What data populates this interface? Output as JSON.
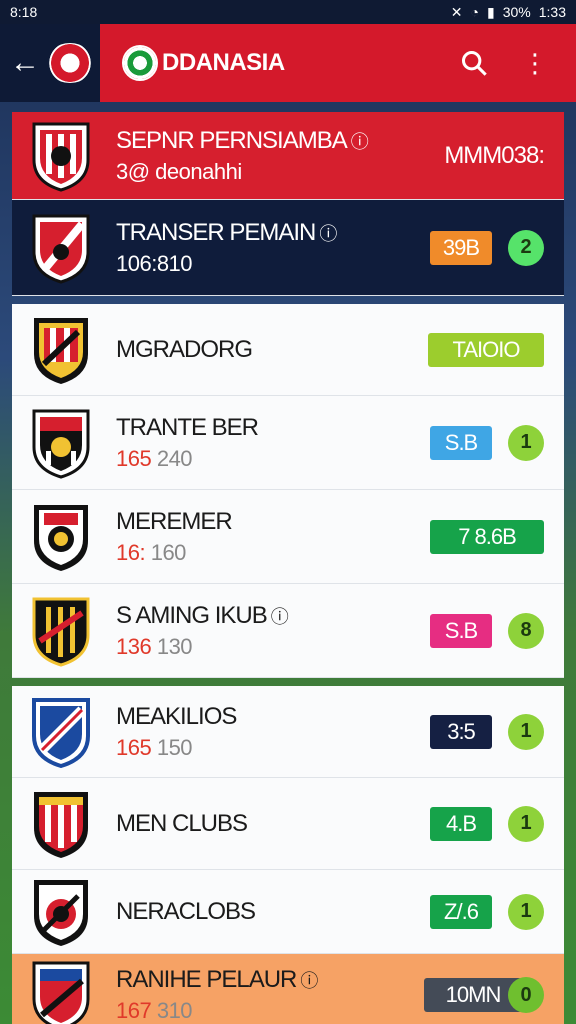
{
  "status_bar": {
    "time": "8:18",
    "battery": "30%",
    "clock": "1:33",
    "icons": [
      "mute-icon",
      "wifi-icon",
      "signal-icon"
    ]
  },
  "app_bar": {
    "brand": "DDANASIA",
    "icons": [
      "back-arrow-icon",
      "search-icon",
      "more-vert-icon"
    ]
  },
  "rows": [
    {
      "name": "SEPNR PERNSIAMBA",
      "sub_prefix": "3@ deonahhi",
      "sub_hl": "",
      "value": "MMM038:"
    },
    {
      "name": "TRANSER PEMAIN",
      "sub_prefix": "106:810",
      "sub_hl": "",
      "badge": "39B",
      "pill": "2"
    },
    {
      "name": "MGRADORG",
      "badge": "TAIOIO"
    },
    {
      "name": "TRANTE BER",
      "sub_hl": "165",
      "sub_rest": " 240",
      "badge": "S.B",
      "pill": "1"
    },
    {
      "name": "MEREMER",
      "sub_hl": "16:",
      "sub_rest": " 160",
      "badge": "7 8.6B"
    },
    {
      "name": "S AMING IKUB",
      "sub_hl": "136",
      "sub_rest": " 130",
      "badge": "S.B",
      "pill": "8"
    },
    {
      "name": "MEAKILIOS",
      "sub_hl": "165",
      "sub_rest": " 150",
      "badge": "3:5",
      "pill": "1"
    },
    {
      "name": "MEN CLUBS",
      "badge": "4.B",
      "pill": "1"
    },
    {
      "name": "NERACLOBS",
      "badge": "Z/.6",
      "pill": "1"
    },
    {
      "name": "RANIHE PELAUR",
      "sub_hl": "167",
      "sub_rest": " 310",
      "badge": "10MN",
      "pill": "0"
    }
  ],
  "colors": {
    "primary_red": "#d4192b",
    "navy": "#0e1a36",
    "badge_orange": "#f08b2a",
    "badge_lime": "#9ccd2d",
    "badge_blue": "#3fa6e5",
    "badge_green": "#16a34a",
    "badge_pink": "#e62d82",
    "badge_navy": "#152043",
    "badge_slate": "#444b57",
    "pill_green": "#8ed23a"
  }
}
